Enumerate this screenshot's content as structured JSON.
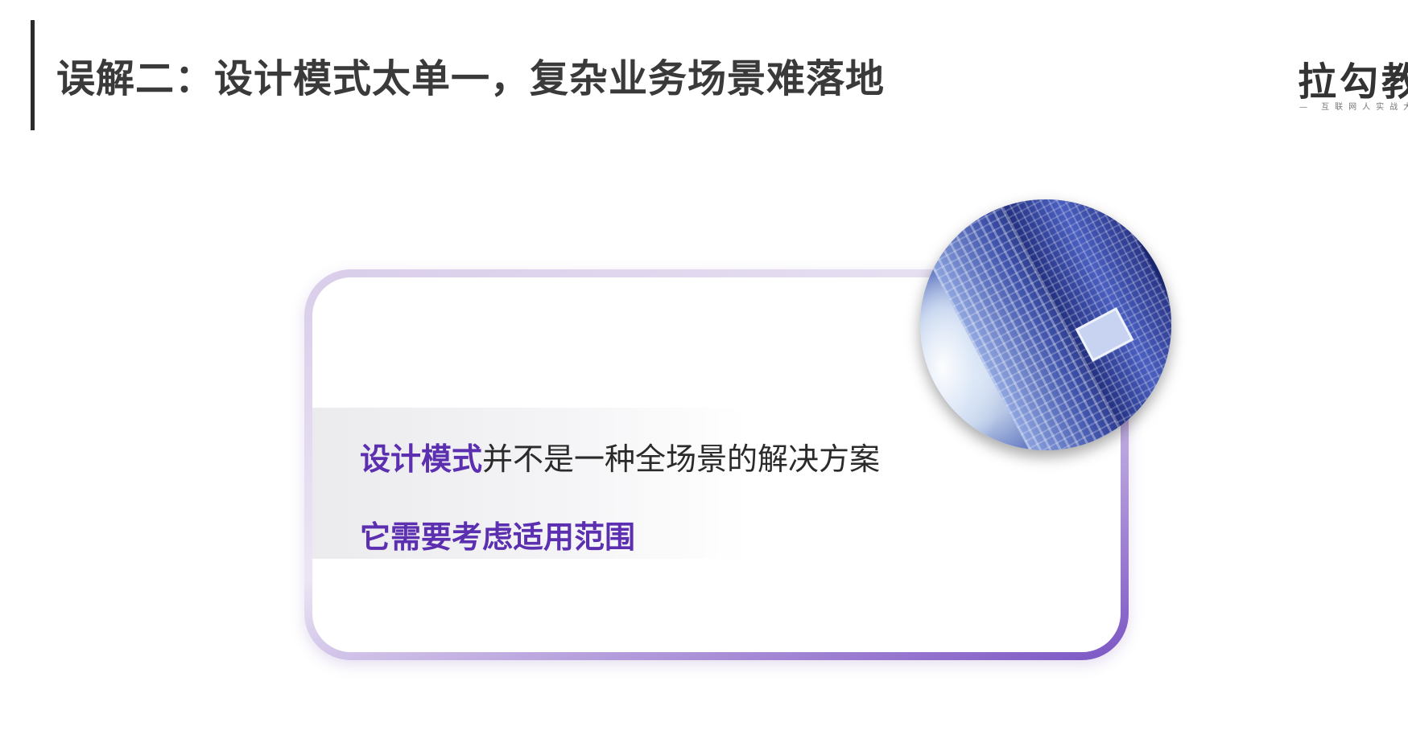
{
  "slide": {
    "title": "误解二：设计模式太单一，复杂业务场景难落地"
  },
  "logo": {
    "text": "拉勾教",
    "tagline": "— 互联网人实战大"
  },
  "card": {
    "line1_accent": "设计模式",
    "line1_rest": "并不是一种全场景的解决方案",
    "line2": "它需要考虑适用范围"
  },
  "colors": {
    "accent": "#5b2fb0",
    "title": "#3a3a3a",
    "card_border": "#7b56c4"
  },
  "icons": {
    "photo": "building-photo"
  }
}
